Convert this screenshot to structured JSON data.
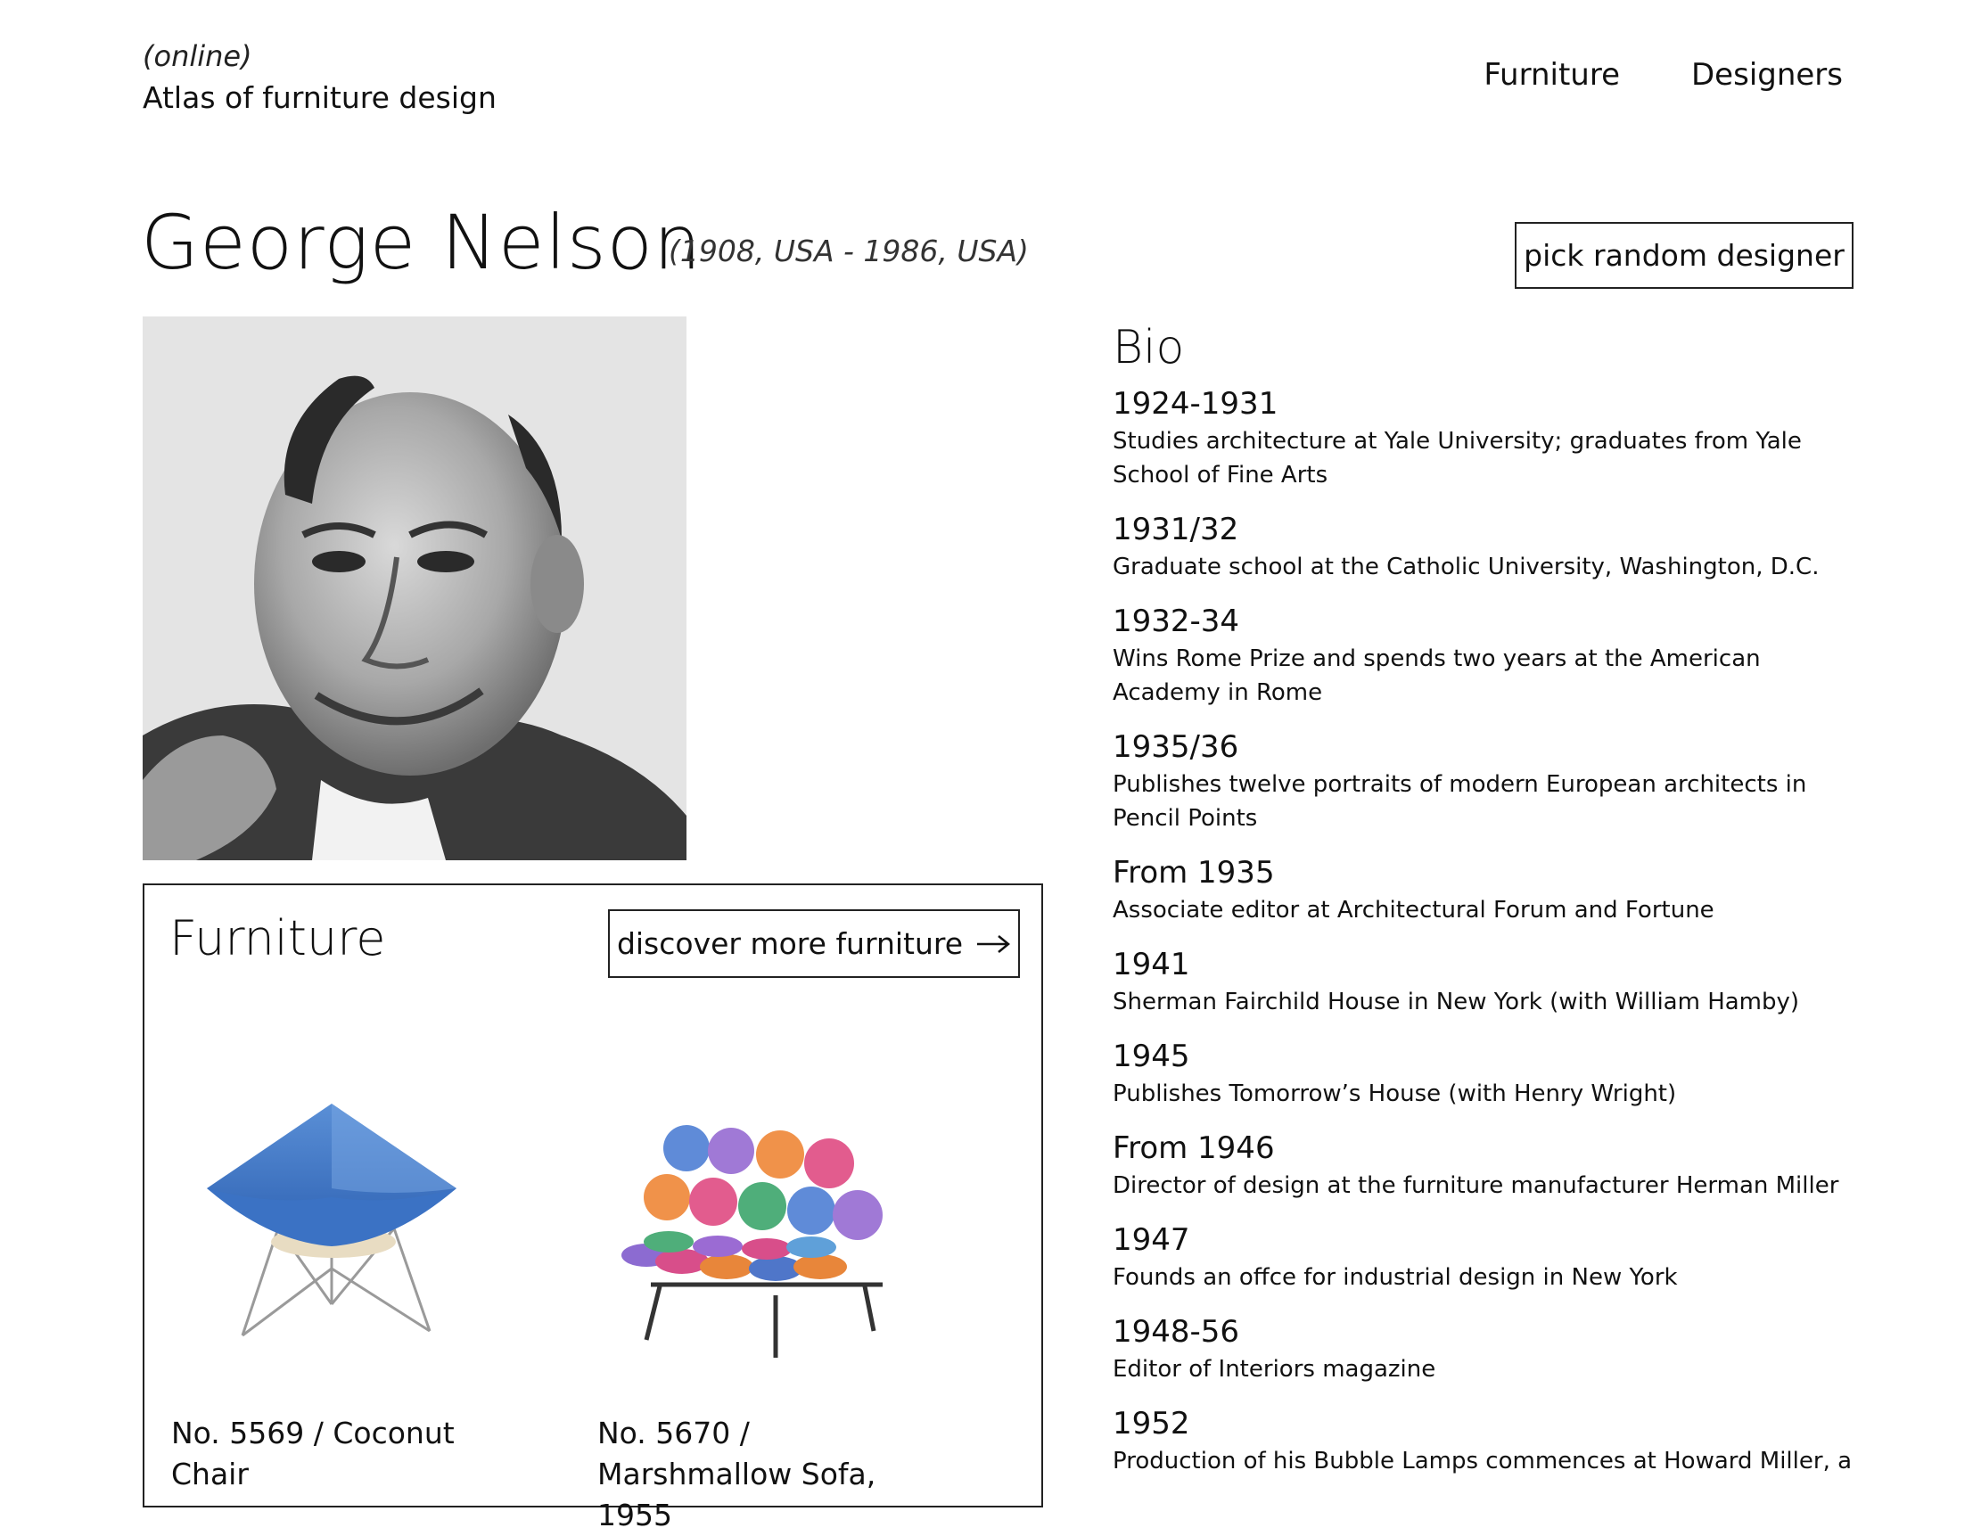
{
  "site": {
    "tag": "(online)",
    "title": "Atlas of furniture design"
  },
  "nav": {
    "items": [
      {
        "label": "Furniture"
      },
      {
        "label": "Designers"
      }
    ]
  },
  "designer": {
    "name": "George Nelson",
    "dates": "(1908, USA - 1986, USA)",
    "random_button": "pick random designer"
  },
  "furniture": {
    "heading": "Furniture",
    "discover_label": "discover more furniture",
    "items": [
      {
        "caption": "No. 5569 / Coconut Chair"
      },
      {
        "caption": "No. 5670 / Marshmallow Sofa, 1955"
      }
    ]
  },
  "bio": {
    "heading": "Bio",
    "entries": [
      {
        "year": "1924-1931",
        "text": "Studies architecture at Yale University; graduates from Yale School of Fine Arts"
      },
      {
        "year": "1931/32",
        "text": "Graduate school at the Catholic University, Washington, D.C."
      },
      {
        "year": "1932-34",
        "text": "Wins Rome Prize and spends two years at the American Academy in Rome"
      },
      {
        "year": "1935/36",
        "text": "Publishes twelve portraits of modern European architects in Pencil Points"
      },
      {
        "year": "From 1935",
        "text": "Associate editor at Architectural Forum and Fortune"
      },
      {
        "year": "1941",
        "text": "Sherman Fairchild House in New York (with William Hamby)"
      },
      {
        "year": "1945",
        "text": "Publishes Tomorrow’s House (with Henry Wright)"
      },
      {
        "year": "From 1946",
        "text": "Director of design at the furniture manufacturer Herman Miller"
      },
      {
        "year": "1947",
        "text": "Founds an offce for industrial design in New York"
      },
      {
        "year": "1948-56",
        "text": "Editor of Interiors magazine"
      },
      {
        "year": "1952",
        "text": "Production of his Bubble Lamps commences at Howard Miller, a"
      }
    ]
  }
}
